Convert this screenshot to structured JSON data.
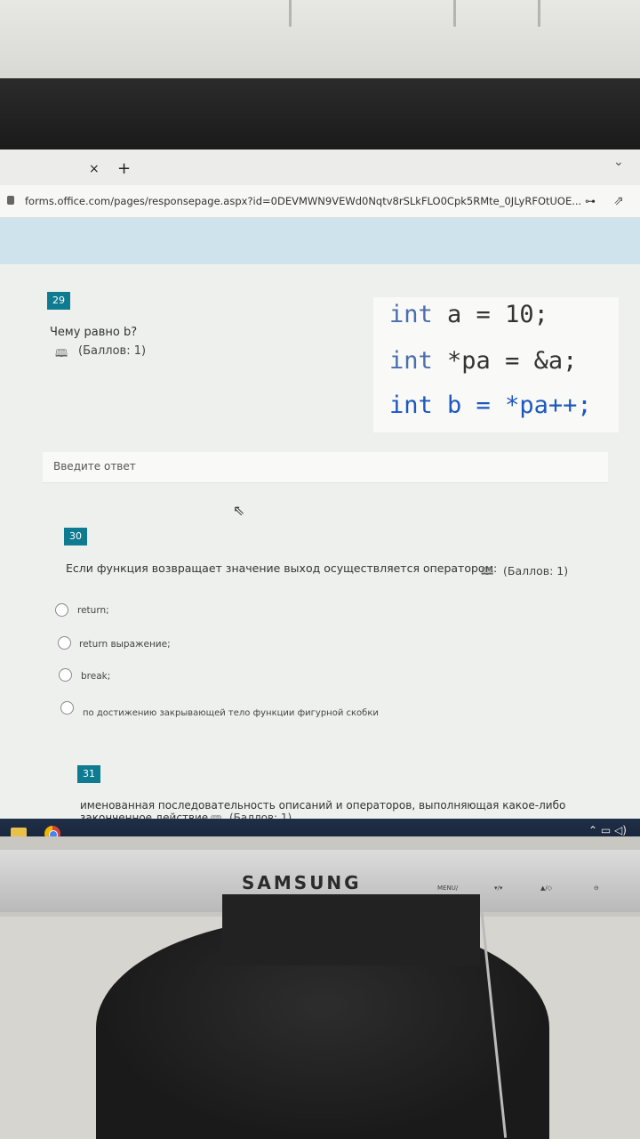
{
  "browser": {
    "tab_close": "×",
    "tab_new": "+",
    "tab_dropdown": "⌄",
    "url": "forms.office.com/pages/responsepage.aspx?id=0DEVMWN9VEWd0Nqtv8rSLkFLO0Cpk5RMte_0JLyRFOtUOE..."
  },
  "q29": {
    "number": "29",
    "question": "Чему равно b?",
    "points": "(Баллов: 1)",
    "code": [
      "int a = 10;",
      "int *pa = &a;",
      "int b = *pa++;"
    ],
    "answer_placeholder": "Введите ответ"
  },
  "q30": {
    "number": "30",
    "question": "Если функция возвращает значение выход осуществляется оператором:",
    "points": "(Баллов: 1)",
    "options": [
      "return;",
      "return выражение;",
      "break;",
      "по достижению закрывающей тело функции фигурной скобки"
    ]
  },
  "q31": {
    "number": "31",
    "question_line1": "именованная последовательность описаний и операторов, выполняющая какое-либо",
    "question_line2": "законченное действие.",
    "points": "(Баллов: 1)"
  },
  "monitor": {
    "brand": "SAMSUNG",
    "menu": "MENU/",
    "btn2": "▾/▾",
    "btn3": "▲/◇",
    "btn4": "⊖"
  },
  "colors": {
    "accent": "#0f7b91",
    "banner": "#cfe3ec"
  }
}
